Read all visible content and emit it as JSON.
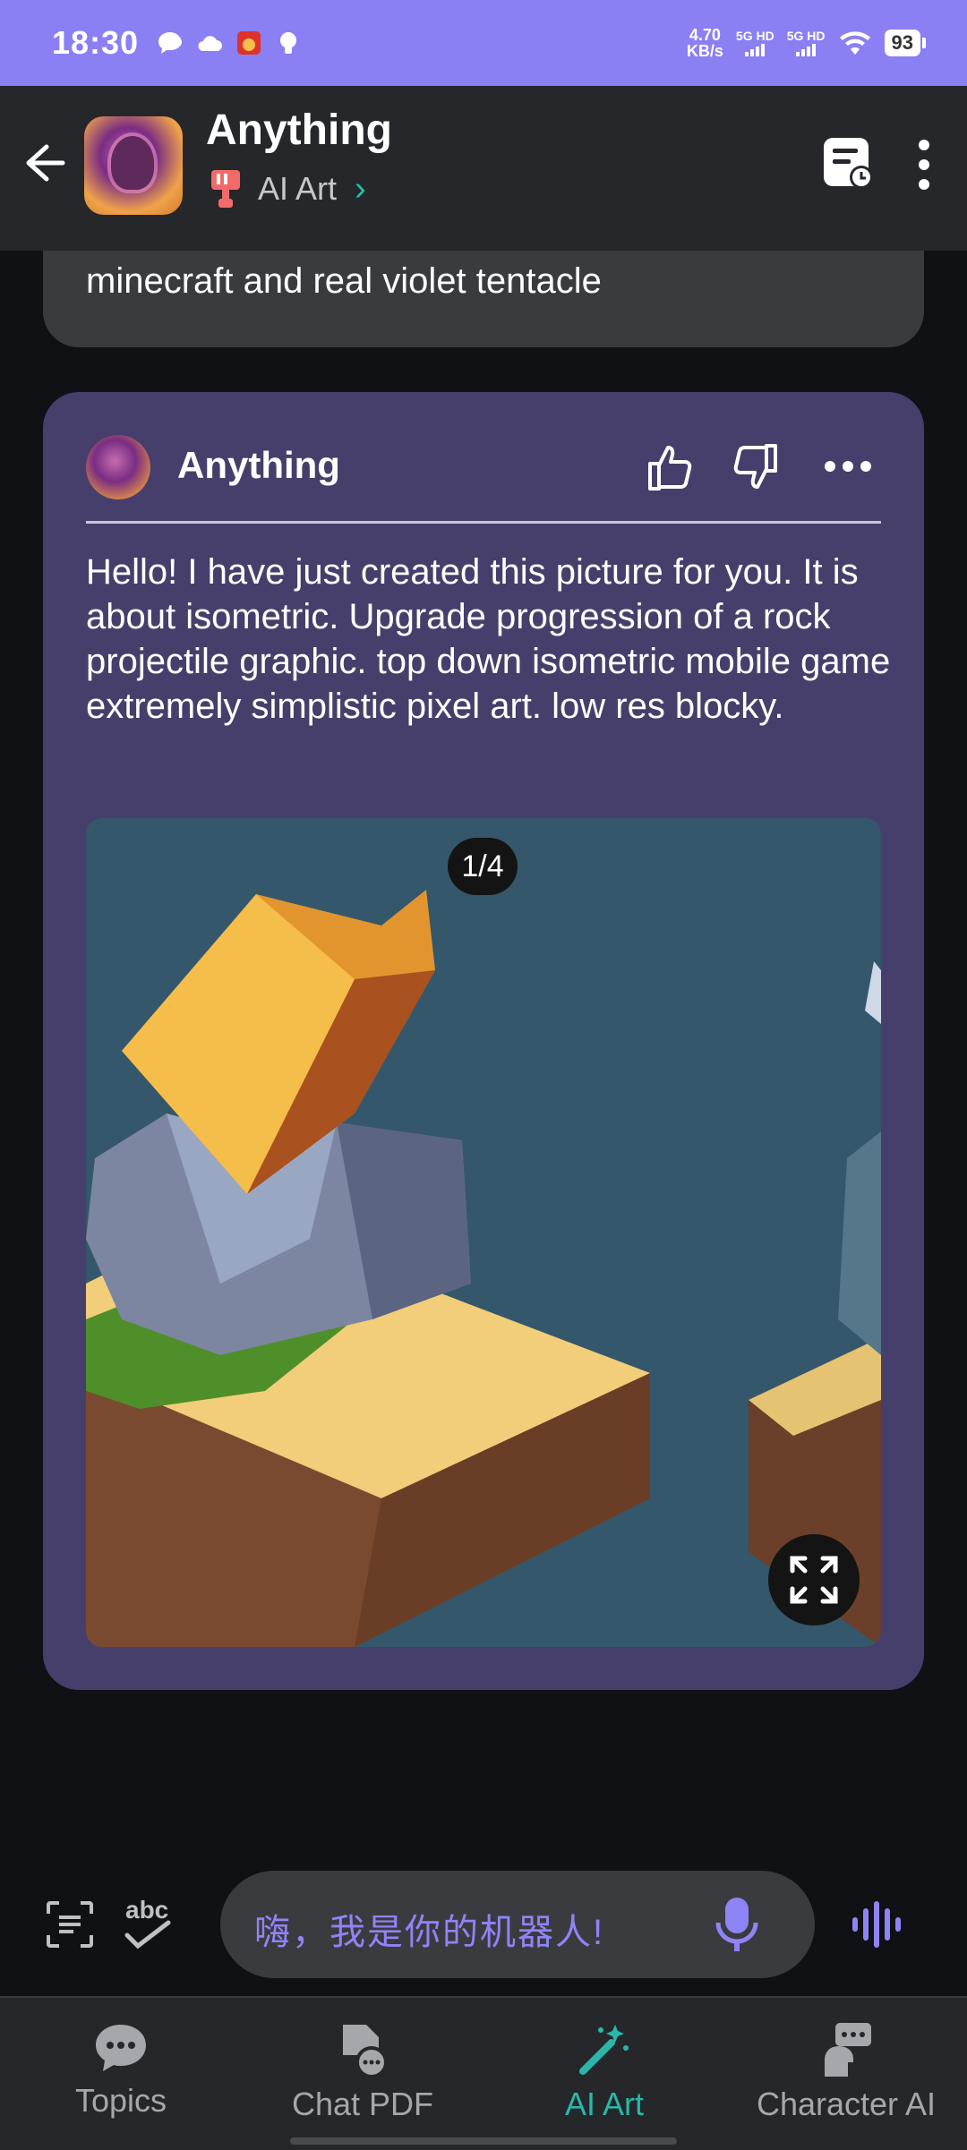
{
  "status_bar": {
    "time": "18:30",
    "net_speed_value": "4.70",
    "net_speed_unit": "KB/s",
    "sim1": "5G HD",
    "sim2": "5G HD",
    "battery": "93"
  },
  "header": {
    "title": "Anything",
    "subtitle": "AI Art",
    "icons": [
      "back-arrow-icon",
      "bot-avatar",
      "ai-art-brush-icon",
      "chevron-right-icon",
      "chat-history-icon",
      "more-vertical-icon"
    ]
  },
  "previous_message": {
    "text": "minecraft and real violet tentacle"
  },
  "reply": {
    "author": "Anything",
    "text": "Hello! I have just created this picture for you. It is about isometric. Upgrade progression of a rock projectile graphic. top down isometric mobile game extremely simplistic pixel art. low res blocky.",
    "image_pager": "1/4"
  },
  "composer": {
    "placeholder": "嗨，我是你的机器人!",
    "abc_label": "abc"
  },
  "tabs": [
    {
      "label": "Topics",
      "icon": "chat-bubble-icon",
      "active": false
    },
    {
      "label": "Chat PDF",
      "icon": "pdf-chat-icon",
      "active": false
    },
    {
      "label": "AI Art",
      "icon": "magic-wand-icon",
      "active": true
    },
    {
      "label": "Character AI",
      "icon": "character-speech-icon",
      "active": false
    }
  ],
  "colors": {
    "status_bar": "#8a80f4",
    "header_bg": "#25272b",
    "card_bg": "#463f6b",
    "accent_teal": "#2ab7a9",
    "accent_purple": "#8f84f5"
  }
}
